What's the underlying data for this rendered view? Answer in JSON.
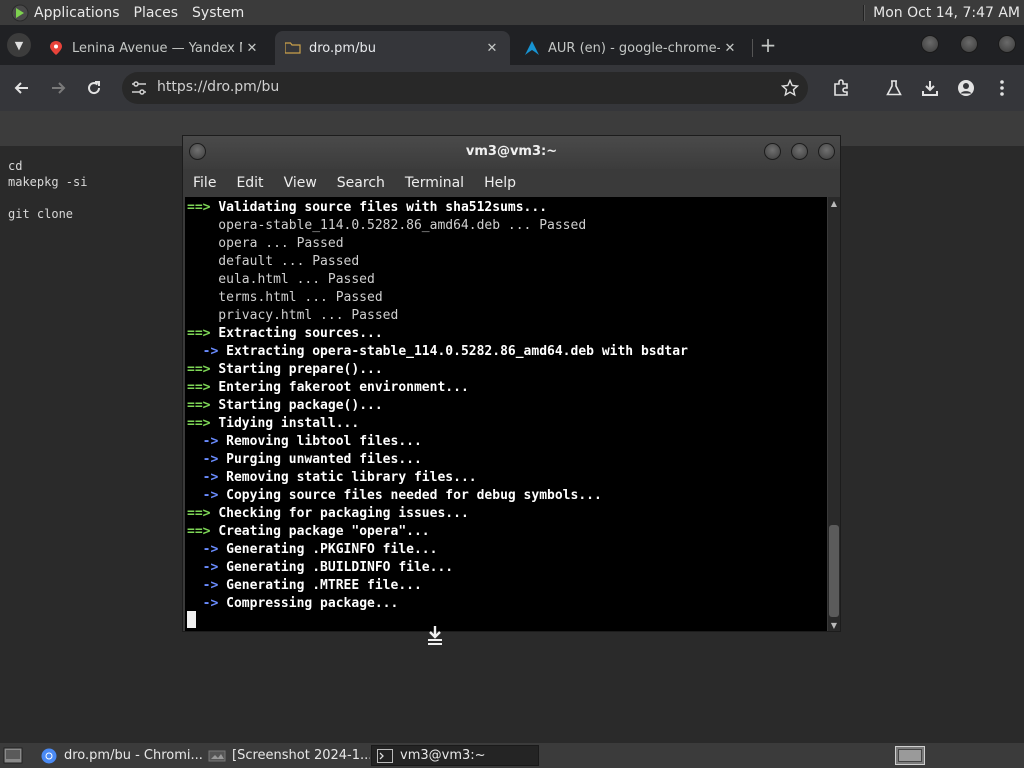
{
  "top_panel": {
    "menus": [
      "Applications",
      "Places",
      "System"
    ],
    "clock": "Mon Oct 14,  7:47 AM"
  },
  "browser": {
    "tabs": [
      {
        "title": "Lenina Avenue — Yandex Ma",
        "favicon": "yandex-maps-pin-icon",
        "active": false
      },
      {
        "title": "dro.pm/bu",
        "favicon": "file-folder-icon",
        "active": true
      },
      {
        "title": "AUR (en) - google-chrome-d",
        "favicon": "arch-linux-icon",
        "active": false
      }
    ],
    "url": "https://dro.pm/bu"
  },
  "page": {
    "lines": [
      "cd",
      "makepkg -si",
      "",
      "git clone"
    ]
  },
  "terminal": {
    "title": "vm3@vm3:~",
    "menu": [
      "File",
      "Edit",
      "View",
      "Search",
      "Terminal",
      "Help"
    ],
    "lines": [
      {
        "prefix": "==>",
        "kind": "major",
        "text": "Validating source files with sha512sums..."
      },
      {
        "prefix": "",
        "kind": "plain",
        "text": "    opera-stable_114.0.5282.86_amd64.deb ... Passed"
      },
      {
        "prefix": "",
        "kind": "plain",
        "text": "    opera ... Passed"
      },
      {
        "prefix": "",
        "kind": "plain",
        "text": "    default ... Passed"
      },
      {
        "prefix": "",
        "kind": "plain",
        "text": "    eula.html ... Passed"
      },
      {
        "prefix": "",
        "kind": "plain",
        "text": "    terms.html ... Passed"
      },
      {
        "prefix": "",
        "kind": "plain",
        "text": "    privacy.html ... Passed"
      },
      {
        "prefix": "==>",
        "kind": "major",
        "text": "Extracting sources..."
      },
      {
        "prefix": "  ->",
        "kind": "minor",
        "text": "Extracting opera-stable_114.0.5282.86_amd64.deb with bsdtar"
      },
      {
        "prefix": "==>",
        "kind": "major",
        "text": "Starting prepare()..."
      },
      {
        "prefix": "==>",
        "kind": "major",
        "text": "Entering fakeroot environment..."
      },
      {
        "prefix": "==>",
        "kind": "major",
        "text": "Starting package()..."
      },
      {
        "prefix": "==>",
        "kind": "major",
        "text": "Tidying install..."
      },
      {
        "prefix": "  ->",
        "kind": "minor",
        "text": "Removing libtool files..."
      },
      {
        "prefix": "  ->",
        "kind": "minor",
        "text": "Purging unwanted files..."
      },
      {
        "prefix": "  ->",
        "kind": "minor",
        "text": "Removing static library files..."
      },
      {
        "prefix": "  ->",
        "kind": "minor",
        "text": "Copying source files needed for debug symbols..."
      },
      {
        "prefix": "==>",
        "kind": "major",
        "text": "Checking for packaging issues..."
      },
      {
        "prefix": "==>",
        "kind": "major",
        "text": "Creating package \"opera\"..."
      },
      {
        "prefix": "  ->",
        "kind": "minor",
        "text": "Generating .PKGINFO file..."
      },
      {
        "prefix": "  ->",
        "kind": "minor",
        "text": "Generating .BUILDINFO file..."
      },
      {
        "prefix": "  ->",
        "kind": "minor",
        "text": "Generating .MTREE file..."
      },
      {
        "prefix": "  ->",
        "kind": "minor",
        "text": "Compressing package..."
      }
    ]
  },
  "taskbar": {
    "tasks": [
      {
        "label": "dro.pm/bu - Chromi...",
        "icon": "chromium-icon",
        "active": false
      },
      {
        "label": "[Screenshot 2024-1...",
        "icon": "screenshot-icon",
        "active": false
      },
      {
        "label": "vm3@vm3:~",
        "icon": "terminal-icon",
        "active": true
      }
    ]
  },
  "colors": {
    "arrow_major": "#7fd857",
    "arrow_minor": "#6a8cff",
    "terminal_bg": "#000000",
    "browser_bg": "#202124"
  }
}
